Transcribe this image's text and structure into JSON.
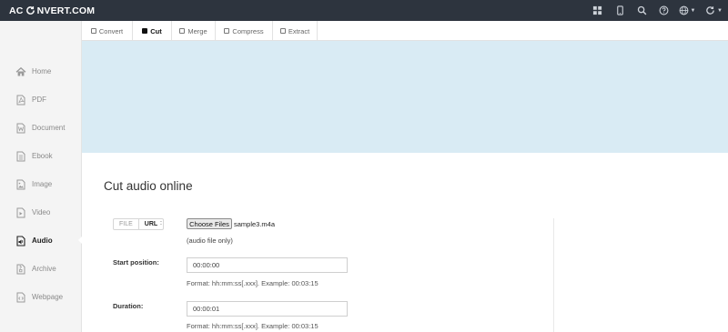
{
  "header": {
    "logo_left": "AC",
    "logo_right": "NVERT.COM",
    "icons": [
      "grid-icon",
      "mobile-icon",
      "search-icon",
      "help-icon",
      "language-icon",
      "refresh-icon"
    ]
  },
  "sidebar": {
    "items": [
      {
        "label": "Home",
        "icon": "home-icon"
      },
      {
        "label": "PDF",
        "icon": "pdf-icon"
      },
      {
        "label": "Document",
        "icon": "document-icon"
      },
      {
        "label": "Ebook",
        "icon": "ebook-icon"
      },
      {
        "label": "Image",
        "icon": "image-icon"
      },
      {
        "label": "Video",
        "icon": "video-icon"
      },
      {
        "label": "Audio",
        "icon": "audio-icon",
        "active": true
      },
      {
        "label": "Archive",
        "icon": "archive-icon"
      },
      {
        "label": "Webpage",
        "icon": "webpage-icon"
      }
    ]
  },
  "tabs": [
    {
      "label": "Convert"
    },
    {
      "label": "Cut",
      "active": true
    },
    {
      "label": "Merge"
    },
    {
      "label": "Compress"
    },
    {
      "label": "Extract"
    }
  ],
  "main": {
    "title": "Cut audio online",
    "source_toggle": {
      "file_label": "FILE",
      "url_label": "URL",
      "selected": "URL",
      "colon": ":"
    },
    "choose_button": "Choose Files",
    "file_name": "sample3.m4a",
    "file_note": "(audio file only)",
    "start_label": "Start position:",
    "start_value": "00:00:00",
    "start_hint": "Format: hh:mm:ss[.xxx]. Example: 00:03:15",
    "duration_label": "Duration:",
    "duration_value": "00:00:01",
    "duration_hint": "Format: hh:mm:ss[.xxx]. Example: 00:03:15"
  },
  "colors": {
    "navbar": "#2d343e",
    "sidebar": "#f4f4f4",
    "banner": "#d9ebf4"
  }
}
